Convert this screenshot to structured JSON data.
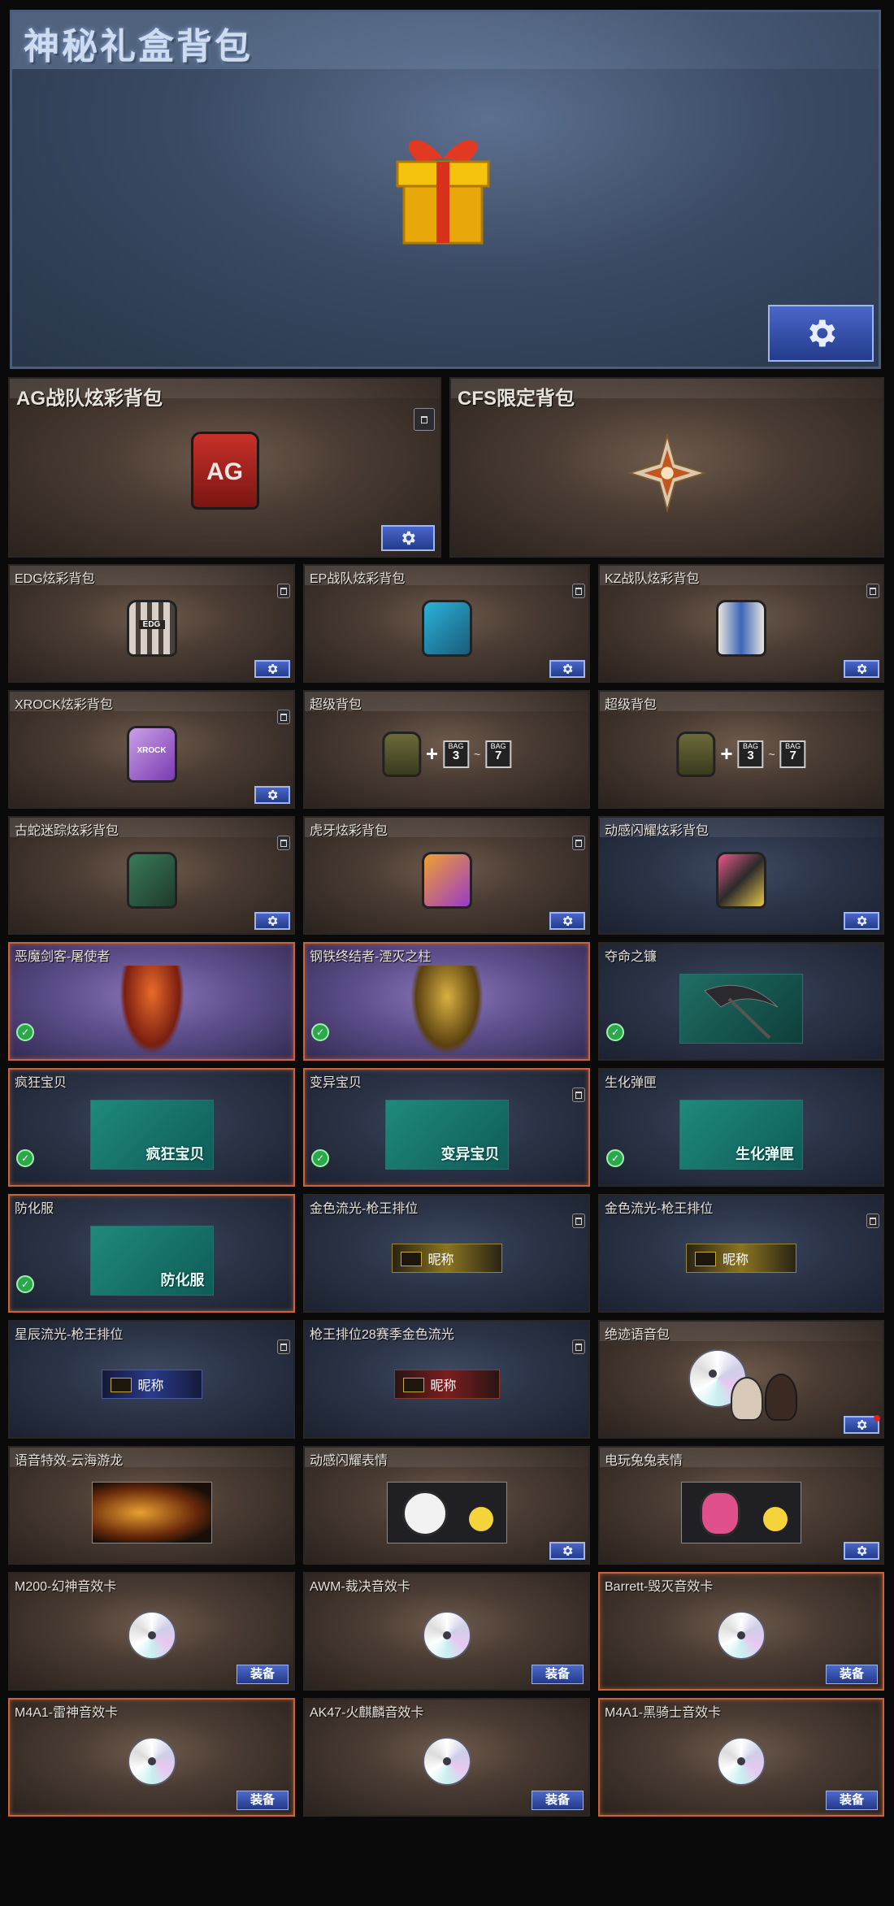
{
  "hero": {
    "title": "神秘礼盒背包"
  },
  "cards_big": [
    {
      "title": "AG战队炫彩背包",
      "icon": "ag-backpack"
    },
    {
      "title": "CFS限定背包",
      "icon": "cfs-star-emblem"
    }
  ],
  "rows": [
    [
      {
        "title": "EDG炫彩背包",
        "bag_text": "EDG"
      },
      {
        "title": "EP战队炫彩背包",
        "bag_text": ""
      },
      {
        "title": "KZ战队炫彩背包",
        "bag_text": ""
      }
    ],
    [
      {
        "title": "XROCK炫彩背包",
        "bag_text": "XROCK"
      },
      {
        "title": "超级背包",
        "tag1": "BAG",
        "tag1_val": "3",
        "tag2": "BAG",
        "tag2_val": "7"
      },
      {
        "title": "超级背包",
        "tag1": "BAG",
        "tag1_val": "3",
        "tag2": "BAG",
        "tag2_val": "7"
      }
    ],
    [
      {
        "title": "古蛇迷踪炫彩背包"
      },
      {
        "title": "虎牙炫彩背包"
      },
      {
        "title": "动感闪耀炫彩背包"
      }
    ],
    [
      {
        "title": "恶魔剑客-屠使者"
      },
      {
        "title": "钢铁终结者-湮灭之柱"
      },
      {
        "title": "夺命之镰"
      }
    ],
    [
      {
        "title": "疯狂宝贝",
        "banner": "疯狂宝贝"
      },
      {
        "title": "变异宝贝",
        "banner": "变异宝贝"
      },
      {
        "title": "生化弹匣",
        "banner": "生化弹匣"
      }
    ],
    [
      {
        "title": "防化服",
        "banner": "防化服"
      },
      {
        "title": "金色流光-枪王排位",
        "nameplate": "昵称"
      },
      {
        "title": "金色流光-枪王排位",
        "nameplate": "昵称"
      }
    ],
    [
      {
        "title": "星辰流光-枪王排位",
        "nameplate": "昵称"
      },
      {
        "title": "枪王排位28赛季金色流光",
        "nameplate": "昵称"
      },
      {
        "title": "绝迹语音包"
      }
    ],
    [
      {
        "title": "语音特效-云海游龙"
      },
      {
        "title": "动感闪耀表情"
      },
      {
        "title": "电玩兔兔表情"
      }
    ],
    [
      {
        "title": "M200-幻神音效卡",
        "equip": "装备"
      },
      {
        "title": "AWM-裁决音效卡",
        "equip": "装备"
      },
      {
        "title": "Barrett-毁灭音效卡",
        "equip": "装备"
      }
    ],
    [
      {
        "title": "M4A1-雷神音效卡",
        "equip": "装备"
      },
      {
        "title": "AK47-火麒麟音效卡",
        "equip": "装备"
      },
      {
        "title": "M4A1-黑骑士音效卡",
        "equip": "装备"
      }
    ]
  ],
  "colors": {
    "accent_button": "#3552b4",
    "highlight_border": "#c9643a",
    "badge_green": "#2aa84a"
  }
}
